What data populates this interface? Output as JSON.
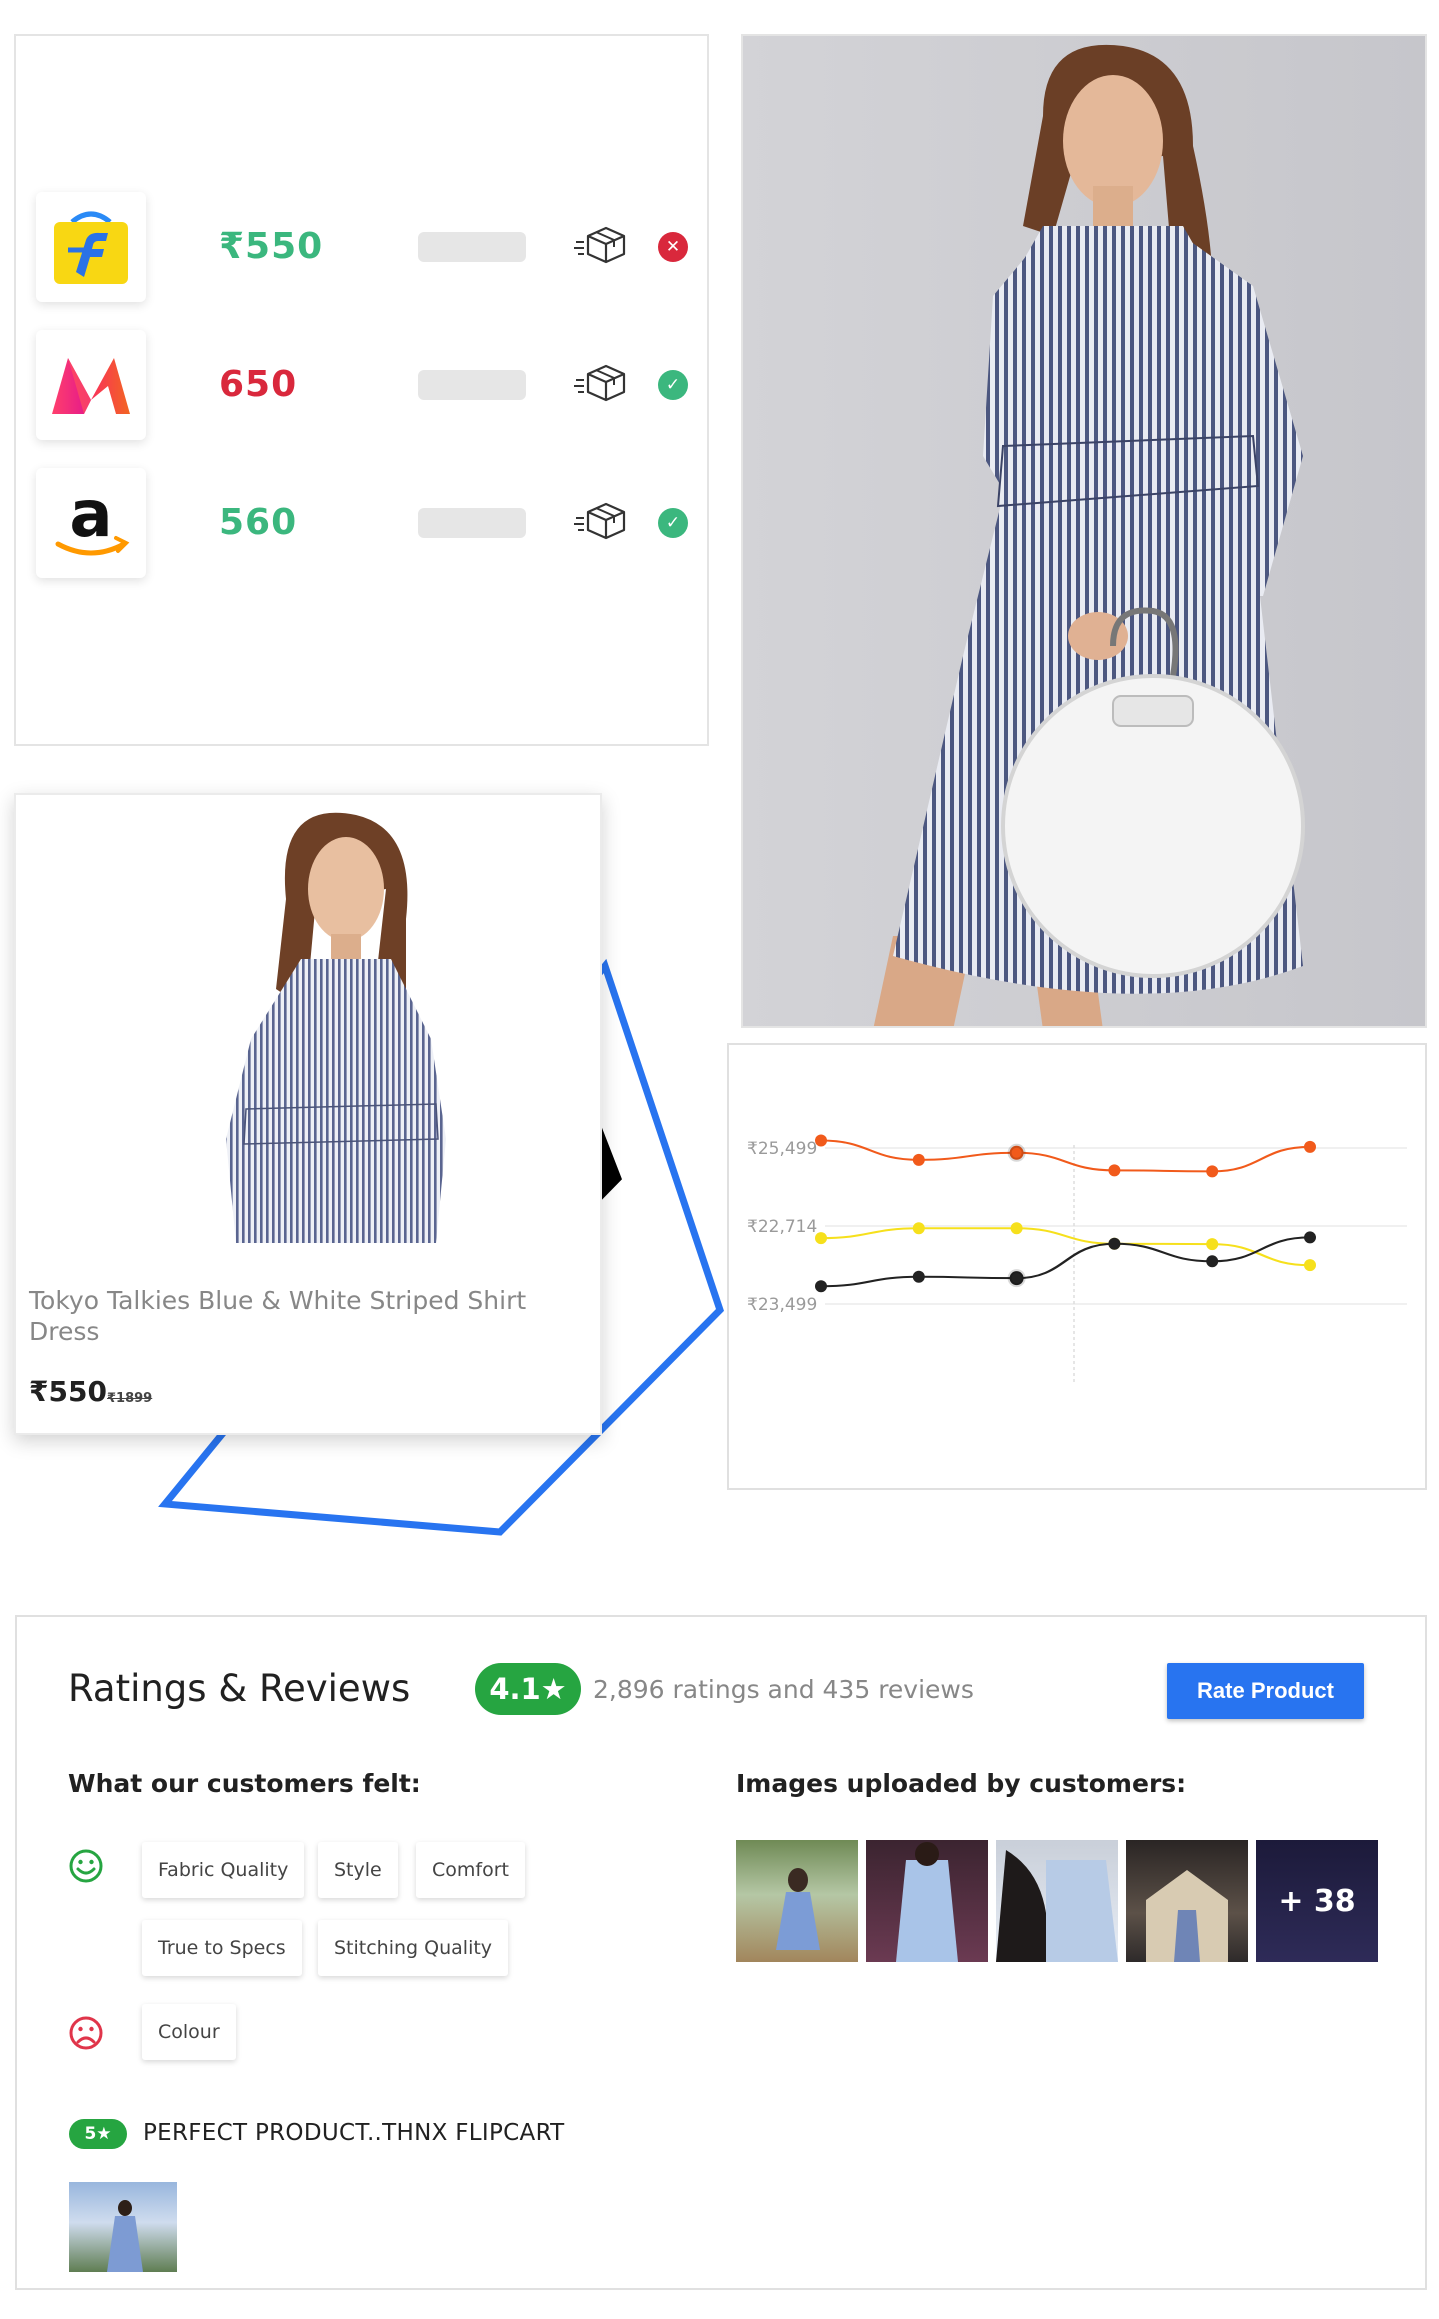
{
  "compare": {
    "rows": [
      {
        "store": "Flipkart",
        "logo_icon": "flipkart-logo-icon",
        "price": "₹550",
        "price_color": "#3bb77e",
        "status": "unavailable",
        "status_color": "#d9283c"
      },
      {
        "store": "Myntra",
        "logo_icon": "myntra-logo-icon",
        "price": "650",
        "price_color": "#d9283c",
        "status": "available",
        "status_color": "#3bb77e"
      },
      {
        "store": "Amazon",
        "logo_icon": "amazon-logo-icon",
        "price": "560",
        "price_color": "#3bb77e",
        "status": "available",
        "status_color": "#3bb77e"
      }
    ]
  },
  "product": {
    "title": "Tokyo Talkies Blue & White Striped Shirt Dress",
    "price": "₹550",
    "mrp": "₹1899"
  },
  "chart_data": {
    "type": "line",
    "title": "",
    "xlabel": "",
    "ylabel": "",
    "y_tick_labels": [
      "₹25,499",
      "₹22,714",
      "₹23,499"
    ],
    "x": [
      1,
      2,
      3,
      4,
      5,
      6
    ],
    "series": [
      {
        "color": "#f15a1b",
        "values": [
          25499,
          24950,
          25150,
          24650,
          24620,
          25320
        ]
      },
      {
        "color": "#f6e01c",
        "values": [
          22720,
          23000,
          23000,
          22560,
          22550,
          21950
        ]
      },
      {
        "color": "#222222",
        "values": [
          21350,
          21620,
          21580,
          22560,
          22060,
          22740
        ]
      }
    ],
    "grid": true,
    "legend": "none"
  },
  "ratings": {
    "title": "Ratings & Reviews",
    "score": "4.1★",
    "summary": "2,896 ratings and 435 reviews",
    "rate_button": "Rate Product",
    "felt_label": "What our customers felt:",
    "positive_icon": "smiley-happy-icon",
    "negative_icon": "smiley-sad-icon",
    "positive_tags": [
      "Fabric Quality",
      "Style",
      "Comfort",
      "True to Specs",
      "Stitching Quality"
    ],
    "negative_tags": [
      "Colour"
    ],
    "images_label": "Images uploaded by customers:",
    "more_images": "+ 38",
    "review": {
      "badge": "5★",
      "text": "PERFECT PRODUCT..THNX FLIPCART"
    }
  }
}
